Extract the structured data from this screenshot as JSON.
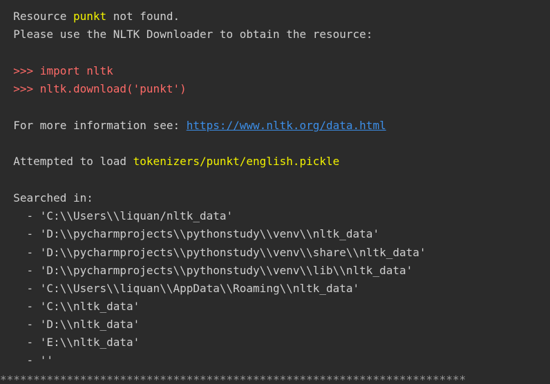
{
  "console": {
    "top_stars": "**********************************************************************",
    "resource_prefix": "  Resource ",
    "resource_name": "punkt",
    "resource_suffix": " not found.",
    "please_use": "  Please use the NLTK Downloader to obtain the resource:",
    "import_line": "  >>> import nltk",
    "download_line": "  >>> nltk.download('punkt')",
    "more_info_prefix": "  For more information see: ",
    "more_info_link": "https://www.nltk.org/data.html",
    "attempted_prefix": "  Attempted to load ",
    "attempted_path": "tokenizers/punkt/english.pickle",
    "searched_in": "  Searched in:",
    "search_paths": [
      "    - 'C:\\\\Users\\\\liquan/nltk_data'",
      "    - 'D:\\\\pycharmprojects\\\\pythonstudy\\\\venv\\\\nltk_data'",
      "    - 'D:\\\\pycharmprojects\\\\pythonstudy\\\\venv\\\\share\\\\nltk_data'",
      "    - 'D:\\\\pycharmprojects\\\\pythonstudy\\\\venv\\\\lib\\\\nltk_data'",
      "    - 'C:\\\\Users\\\\liquan\\\\AppData\\\\Roaming\\\\nltk_data'",
      "    - 'C:\\\\nltk_data'",
      "    - 'D:\\\\nltk_data'",
      "    - 'E:\\\\nltk_data'",
      "    - ''"
    ],
    "bottom_stars": "**********************************************************************",
    "colors": {
      "background": "#2b2b2b",
      "text": "#d0d0d0",
      "highlight": "#f2f200",
      "command": "#ff6b68",
      "link": "#3d8fe8"
    }
  }
}
